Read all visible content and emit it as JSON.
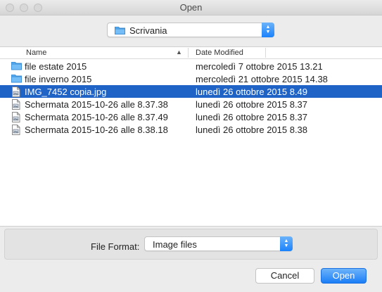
{
  "window": {
    "title": "Open"
  },
  "location": {
    "value": "Scrivania"
  },
  "columns": {
    "name": "Name",
    "date": "Date Modified"
  },
  "files": [
    {
      "name": "file estate 2015",
      "date": "mercoledì 7 ottobre 2015 13.21",
      "kind": "folder-icon",
      "selected": false
    },
    {
      "name": "file inverno 2015",
      "date": "mercoledì 21 ottobre 2015 14.38",
      "kind": "folder-icon",
      "selected": false
    },
    {
      "name": "IMG_7452 copia.jpg",
      "date": "lunedì 26 ottobre 2015 8.49",
      "kind": "image-file-icon",
      "selected": true
    },
    {
      "name": "Schermata 2015-10-26 alle 8.37.38",
      "date": "lunedì 26 ottobre 2015 8.37",
      "kind": "image-file-icon",
      "selected": false
    },
    {
      "name": "Schermata 2015-10-26 alle 8.37.49",
      "date": "lunedì 26 ottobre 2015 8.37",
      "kind": "image-file-icon",
      "selected": false
    },
    {
      "name": "Schermata 2015-10-26 alle 8.38.18",
      "date": "lunedì 26 ottobre 2015 8.38",
      "kind": "image-file-icon",
      "selected": false
    }
  ],
  "format": {
    "label": "File Format:",
    "value": "Image files"
  },
  "buttons": {
    "cancel": "Cancel",
    "open": "Open"
  },
  "colors": {
    "selection": "#1f63c7",
    "accent": "#1b7ef6",
    "folder": "#5aaef3"
  }
}
